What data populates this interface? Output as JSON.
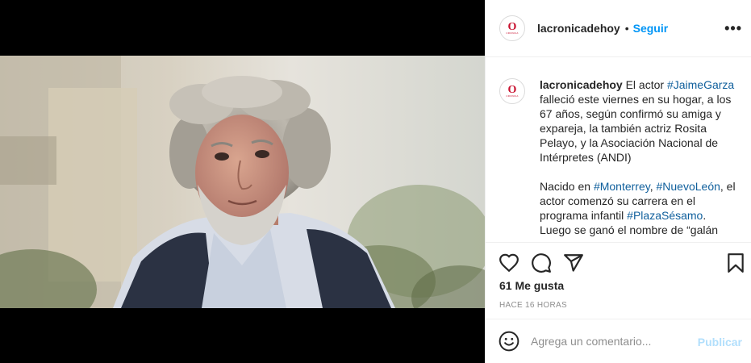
{
  "post": {
    "username": "lacronicadehoy",
    "dot": "•",
    "follow_label": "Seguir",
    "more_label": "•••",
    "avatar_letter": "O",
    "avatar_small_text": "CRONICA"
  },
  "caption": {
    "username": "lacronicadehoy",
    "p1_a": " El actor ",
    "p1_tag": "#JaimeGarza",
    "p1_b": " falleció este viernes en su hogar, a los 67 años, según confirmó su amiga y expareja, la también actriz Rosita Pelayo, y la Asociación Nacional de Intérpretes (ANDI)",
    "p2_a": "Nacido en ",
    "p2_tag1": "#Monterrey",
    "p2_comma": ", ",
    "p2_tag2": "#NuevoLeón",
    "p2_b": ", el actor comenzó su carrera en el programa infantil ",
    "p2_tag3": "#PlazaSésamo",
    "p2_c": ". Luego se ganó el nombre de “galán"
  },
  "stats": {
    "likes": "61 Me gusta",
    "time": "HACE 16 HORAS"
  },
  "comment": {
    "placeholder": "Agrega un comentario...",
    "publish_label": "Publicar"
  },
  "colors": {
    "accent": "#0095f6",
    "publish_disabled": "#b2dffc",
    "hashtag": "#0f5f9c",
    "brand_red": "#c8102e"
  }
}
